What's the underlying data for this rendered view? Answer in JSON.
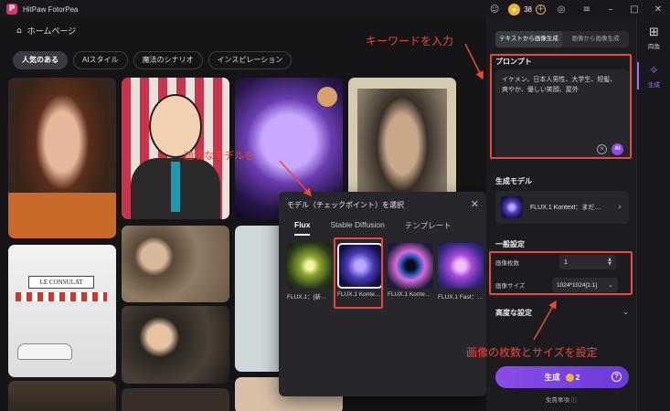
{
  "app": {
    "title": "HitPaw FotorPea",
    "logo_letter": "P"
  },
  "titlebar": {
    "coins": "38"
  },
  "header": {
    "home_label": "ホームページ"
  },
  "categories": [
    {
      "label": "人気のある",
      "active": true
    },
    {
      "label": "AIスタイル",
      "active": false
    },
    {
      "label": "魔法のシナリオ",
      "active": false
    },
    {
      "label": "インスピレーション",
      "active": false
    }
  ],
  "gallery": {
    "tile5_sign": "LE CONSULAT"
  },
  "dialog": {
    "title": "モデル（チェックポイント）を選択",
    "tabs": [
      {
        "label": "Flux",
        "active": true
      },
      {
        "label": "Stable Diffusion",
        "active": false
      },
      {
        "label": "テンプレート",
        "active": false
      }
    ],
    "models": [
      {
        "label": "FLUX.1：[新…",
        "selected": false
      },
      {
        "label": "FLUX.1 Konte…",
        "selected": true
      },
      {
        "label": "FLUX.1 Konte…",
        "selected": false
      },
      {
        "label": "FLUX.1 Fast：…",
        "selected": false
      }
    ]
  },
  "panel": {
    "mode_tabs": [
      {
        "label": "テキストから画像生成",
        "active": true
      },
      {
        "label": "画像から画像生成",
        "active": false
      }
    ],
    "prompt_label": "プロンプト",
    "prompt_text": "イケメン、日本人男性、大学生、短髪、爽やか、優しい笑顔、屋外",
    "prompt_ai": "AI",
    "model_label": "生成モデル",
    "model_name": "FLUX.1 Kontext：まだ…",
    "general_label": "一般設定",
    "count_label": "画像枚数",
    "count_value": "1",
    "size_label": "画像サイズ",
    "size_value": "1024*1024[1:1]",
    "advanced_label": "高度な設定",
    "generate_label": "生成",
    "generate_cost": "2",
    "disclaimer": "免責事項"
  },
  "rail": [
    {
      "icon": "grid-icon",
      "label": "四角",
      "active": false
    },
    {
      "icon": "sparkle-icon",
      "label": "生成",
      "active": true
    }
  ],
  "annotations": {
    "keyword": "キーワードを入力",
    "model": "適切なモデルを",
    "settings": "画像の枚数とサイズを設定",
    "color": "#e84a3a"
  }
}
